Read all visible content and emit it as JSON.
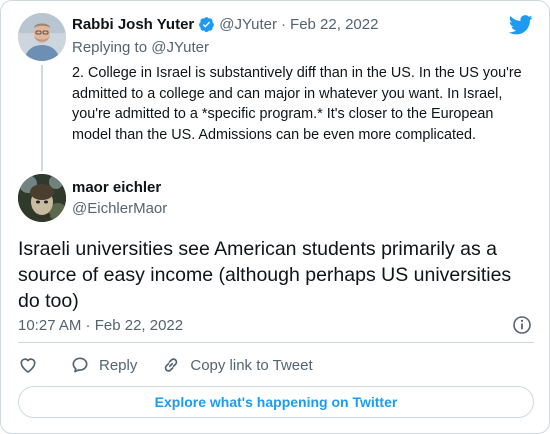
{
  "parent_tweet": {
    "author_name": "Rabbi Josh Yuter",
    "author_handle": "@JYuter",
    "separator": "·",
    "date": "Feb 22, 2022",
    "replying_label": "Replying to",
    "replying_handle": "@JYuter",
    "text": "2. College in Israel is substantively diff than in the US. In the US you're admitted to a college and can major in whatever you want. In Israel, you're admitted to a *specific program.* It's closer to the European model than the US. Admissions can be even more complicated."
  },
  "tweet": {
    "author_name": "maor eichler",
    "author_handle": "@EichlerMaor",
    "text": "Israeli universities see American students primarily as a source of easy income (although perhaps US universities do too)",
    "timestamp": "10:27 AM · Feb 22, 2022"
  },
  "actions": {
    "reply_label": "Reply",
    "copy_link_label": "Copy link to Tweet"
  },
  "explore_button_label": "Explore what's happening on Twitter",
  "icons": {
    "brand": "twitter-bird-icon",
    "verified": "verified-badge-icon",
    "info": "info-icon",
    "like": "heart-icon",
    "reply": "speech-bubble-icon",
    "copy_link": "link-icon"
  },
  "colors": {
    "accent": "#1d9bf0",
    "text": "#0f1419",
    "muted": "#536471",
    "border": "#cfd9de"
  }
}
